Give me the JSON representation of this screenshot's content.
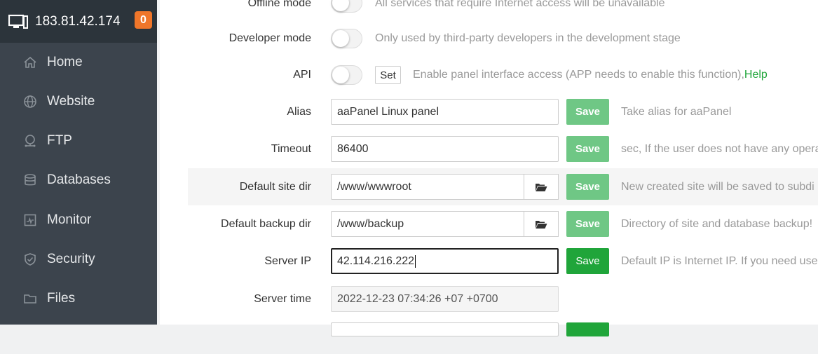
{
  "sidebar": {
    "ip": "183.81.42.174",
    "badge": "0",
    "items": [
      {
        "label": "Home",
        "icon": "home-icon"
      },
      {
        "label": "Website",
        "icon": "globe-icon"
      },
      {
        "label": "FTP",
        "icon": "ftp-icon"
      },
      {
        "label": "Databases",
        "icon": "database-icon"
      },
      {
        "label": "Monitor",
        "icon": "monitor-icon"
      },
      {
        "label": "Security",
        "icon": "shield-icon"
      },
      {
        "label": "Files",
        "icon": "folder-icon"
      }
    ]
  },
  "settings": {
    "offline": {
      "label": "Offline mode",
      "desc": "All services that require Internet access will be unavailable"
    },
    "developer": {
      "label": "Developer mode",
      "desc": "Only used by third-party developers in the development stage"
    },
    "api": {
      "label": "API",
      "set": "Set",
      "desc": "Enable panel interface access (APP needs to enable this function),",
      "help": "Help"
    },
    "alias": {
      "label": "Alias",
      "value": "aaPanel Linux panel",
      "save": "Save",
      "desc": "Take alias for aaPanel"
    },
    "timeout": {
      "label": "Timeout",
      "value": "86400",
      "save": "Save",
      "desc": "sec, If the user does not have any opera"
    },
    "site_dir": {
      "label": "Default site dir",
      "value": "/www/wwwroot",
      "save": "Save",
      "desc": "New created site will be saved to subdi"
    },
    "backup_dir": {
      "label": "Default backup dir",
      "value": "/www/backup",
      "save": "Save",
      "desc": "Directory of site and database backup!"
    },
    "server_ip": {
      "label": "Server IP",
      "value": "42.114.216.222",
      "save": "Save",
      "desc": "Default IP is Internet IP. If you need use"
    },
    "server_time": {
      "label": "Server time",
      "value": "2022-12-23 07:34:26 +07 +0700"
    }
  },
  "colors": {
    "sidebar": "#3c444d",
    "sidebar_head": "#2c343b",
    "badge": "#f0762a",
    "accent": "#20a53a",
    "save_light": "#6fc785"
  }
}
